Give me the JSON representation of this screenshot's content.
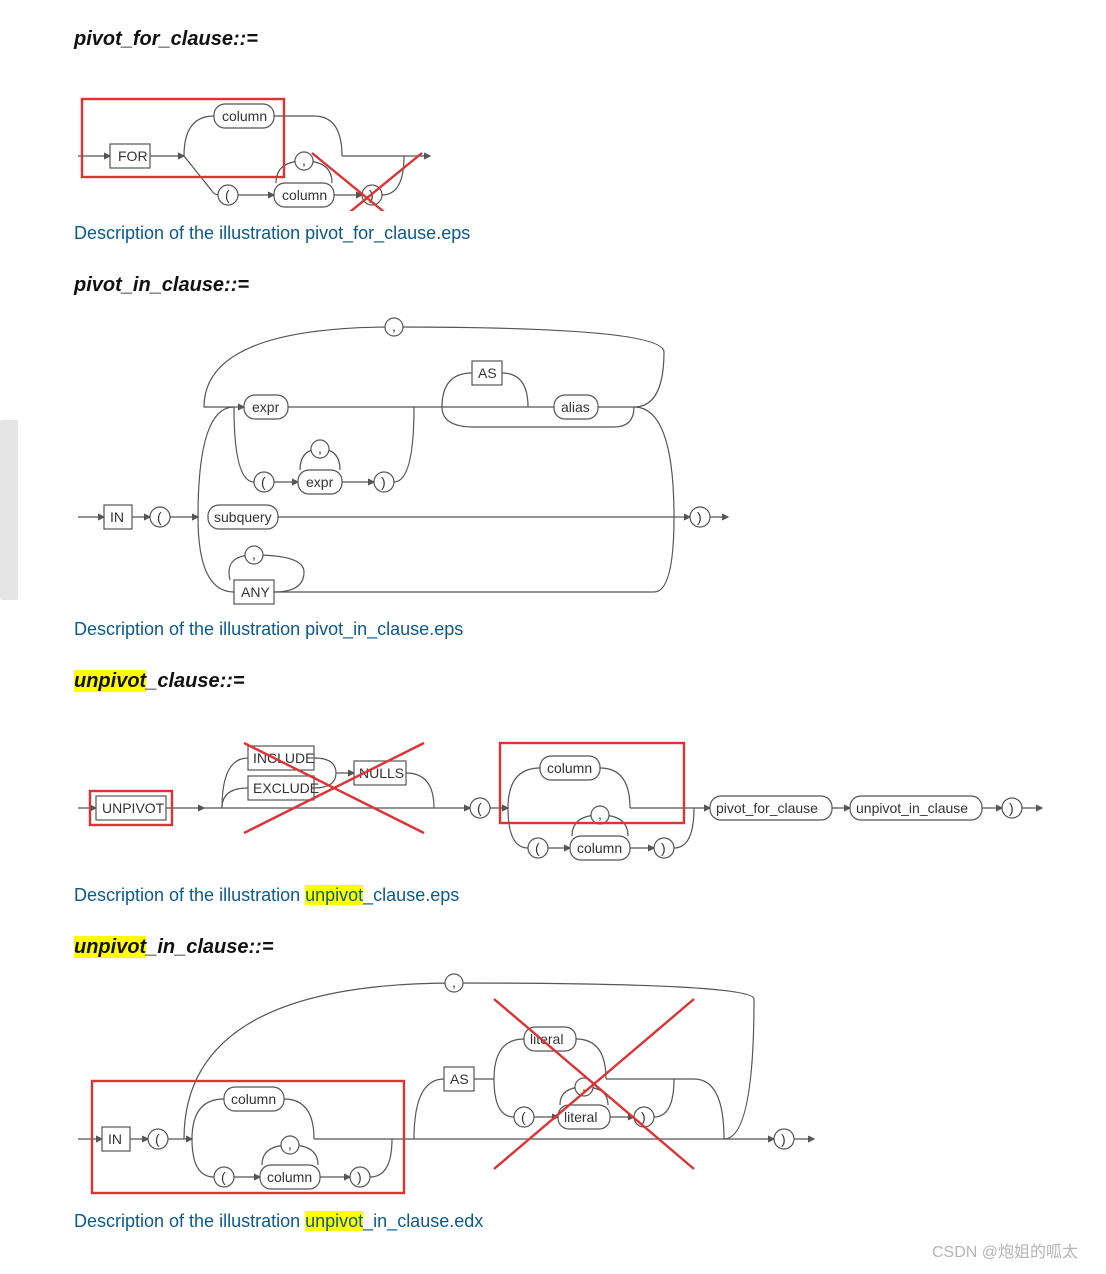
{
  "sections": [
    {
      "title": "pivot_for_clause::=",
      "title_hl": null,
      "desc_pre": "Description of the illustration ",
      "desc_hl": null,
      "desc_post": "pivot_for_clause.eps",
      "nodes": {
        "for": "FOR",
        "column": "column",
        "comma": ","
      }
    },
    {
      "title": "pivot_in_clause::=",
      "title_hl": null,
      "desc_pre": "Description of the illustration ",
      "desc_hl": null,
      "desc_post": "pivot_in_clause.eps",
      "nodes": {
        "in": "IN",
        "lp": "(",
        "rp": ")",
        "expr": "expr",
        "comma": ",",
        "subquery": "subquery",
        "any": "ANY",
        "as": "AS",
        "alias": "alias"
      }
    },
    {
      "title_pre": "",
      "title_hl": "unpivot",
      "title_post": "_clause::=",
      "desc_pre": "Description of the illustration ",
      "desc_hl": "unpivot",
      "desc_post": "_clause.eps",
      "nodes": {
        "unpivot": "UNPIVOT",
        "include": "INCLUDE",
        "exclude": "EXCLUDE",
        "nulls": "NULLS",
        "lp": "(",
        "rp": ")",
        "column": "column",
        "comma": ",",
        "pfc": "pivot_for_clause",
        "uic": "unpivot_in_clause"
      }
    },
    {
      "title_pre": "",
      "title_hl": "unpivot",
      "title_post": "_in_clause::=",
      "desc_pre": "Description of the illustration ",
      "desc_hl": "unpivot",
      "desc_post": "_in_clause.edx",
      "nodes": {
        "in": "IN",
        "lp": "(",
        "rp": ")",
        "column": "column",
        "comma": ",",
        "as": "AS",
        "literal": "literal"
      }
    }
  ],
  "watermark": "CSDN @炮姐的呱太"
}
